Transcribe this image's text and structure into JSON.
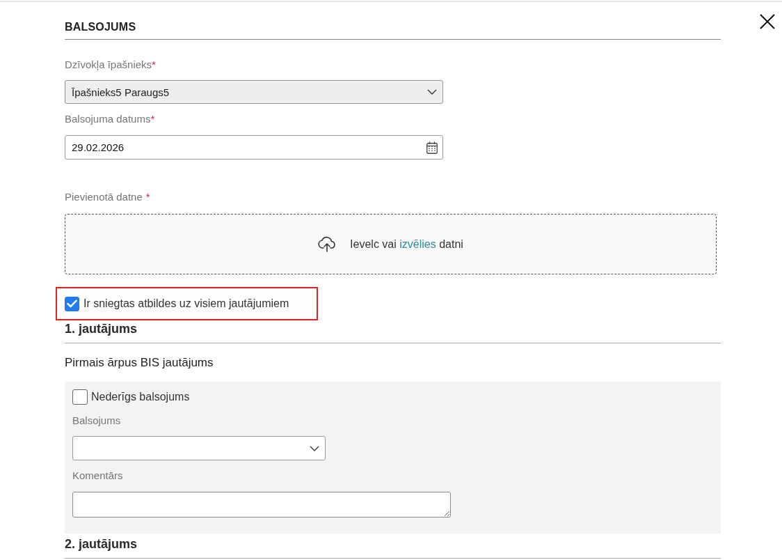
{
  "dialog": {
    "title": "BALSOJUMS"
  },
  "fields": [
    {
      "kind": "select",
      "label": "Dzīvokļa īpašnieks",
      "required_mark": "*",
      "value": "Īpašnieks5 Paraugs5",
      "disabled": true
    },
    {
      "kind": "date",
      "label": "Balsojuma datums",
      "required_mark": "*",
      "value": "29.02.2026"
    },
    {
      "kind": "upload",
      "label": "Pievienotā datne",
      "required_mark": "*",
      "prompt_before": "Ievelc vai",
      "link": "izvēlies",
      "prompt_after": "datni"
    }
  ],
  "all_answered": {
    "label": "Ir sniegtas atbildes uz visiem jautājumiem",
    "checked": true,
    "highlighted": true
  },
  "questions": [
    {
      "heading": "1. jautājums",
      "text": "Pirmais ārpus BIS jautājums",
      "invalid_vote": {
        "label": "Nederīgs balsojums",
        "checked": false
      },
      "vote": {
        "label": "Balsojums",
        "disabled": false
      },
      "comment": {
        "label": "Komentārs"
      }
    },
    {
      "heading": "2. jautājums"
    }
  ]
}
